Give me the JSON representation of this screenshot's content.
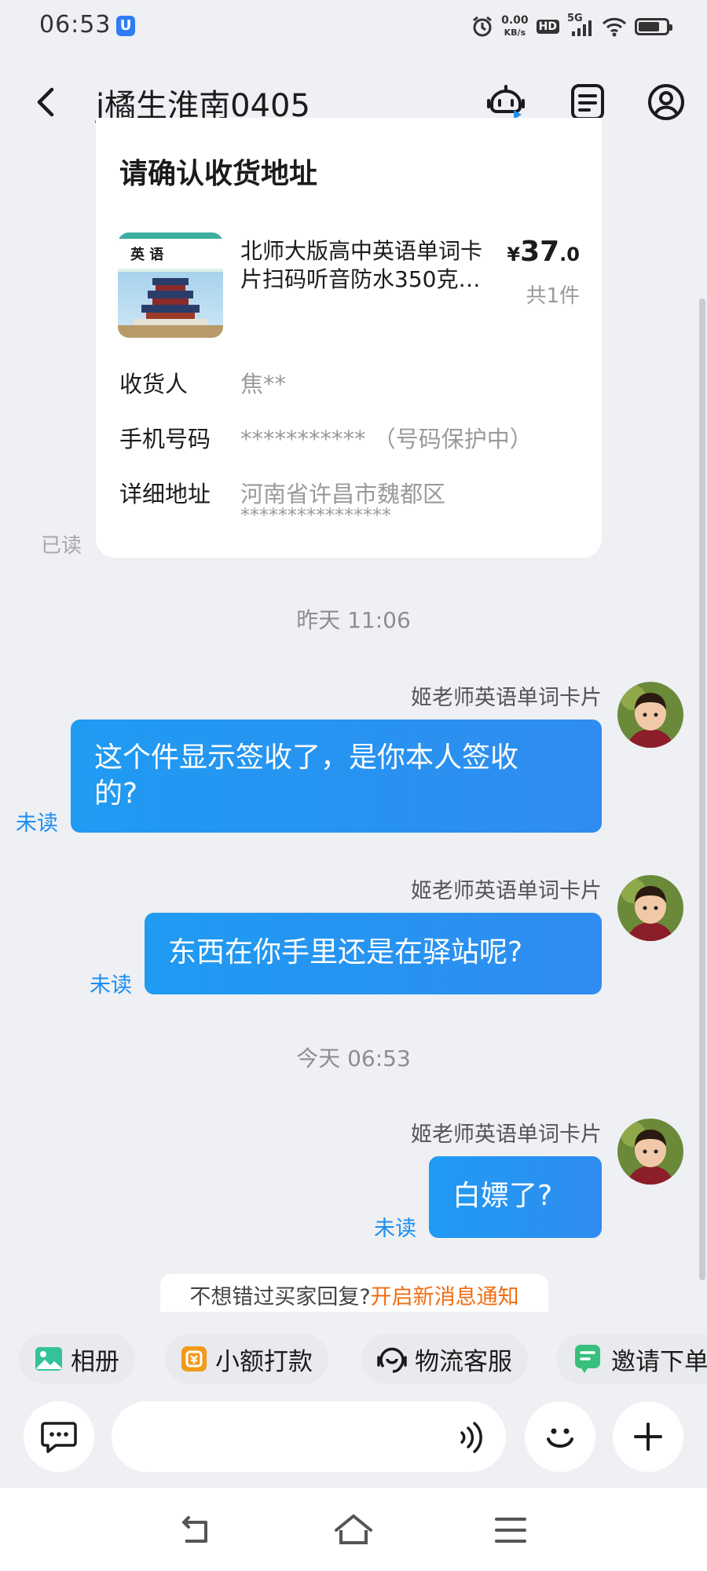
{
  "status_bar": {
    "time": "06:53",
    "app_badge": "U",
    "net_speed_value": "0.00",
    "net_speed_unit": "KB/s",
    "hd": "HD",
    "signal": "5G",
    "icons": [
      "alarm-icon",
      "wifi-icon",
      "battery-icon"
    ],
    "battery_level": 0.8
  },
  "header": {
    "title": "j橘生淮南0405",
    "icons": [
      "back-icon",
      "robot-assistant-icon",
      "order-list-icon",
      "profile-icon"
    ]
  },
  "order_card": {
    "title": "请确认收货地址",
    "product": {
      "thumb_text": "英 语",
      "name_line1": "北师大版高中英语单词卡",
      "name_line2": "片扫码听音防水350克…",
      "currency": "¥",
      "price_int": "37",
      "price_dec": ".0",
      "qty": "共1件"
    },
    "fields": [
      {
        "label": "收货人",
        "value": "焦**"
      },
      {
        "label": "手机号码",
        "value": "*********** （号码保护中）"
      },
      {
        "label": "详细地址",
        "value": "河南省许昌市魏都区",
        "value2": "****************"
      }
    ],
    "read_status": "已读"
  },
  "timestamps": [
    "昨天  11:06",
    "今天  06:53"
  ],
  "messages": [
    {
      "sender": "姬老师英语单词卡片",
      "line1": "这个件显示签收了，是你本人签收",
      "line2": "的?",
      "status": "未读"
    },
    {
      "sender": "姬老师英语单词卡片",
      "line1": "东西在你手里还是在驿站呢?",
      "status": "未读"
    },
    {
      "sender": "姬老师英语单词卡片",
      "line1": "白嫖了?",
      "status": "未读"
    }
  ],
  "notify": {
    "text": "不想错过买家回复?",
    "link": "开启新消息通知"
  },
  "quick_actions": [
    {
      "label": "相册",
      "icon": "album-icon"
    },
    {
      "label": "小额打款",
      "icon": "payment-icon"
    },
    {
      "label": "物流客服",
      "icon": "logistics-service-icon"
    },
    {
      "label": "邀请下单",
      "icon": "invite-order-icon"
    }
  ],
  "input": {
    "placeholder": ""
  },
  "colors": {
    "accent": "#1f9bf2",
    "notify_link": "#f06d12",
    "background": "#eef0f4"
  }
}
